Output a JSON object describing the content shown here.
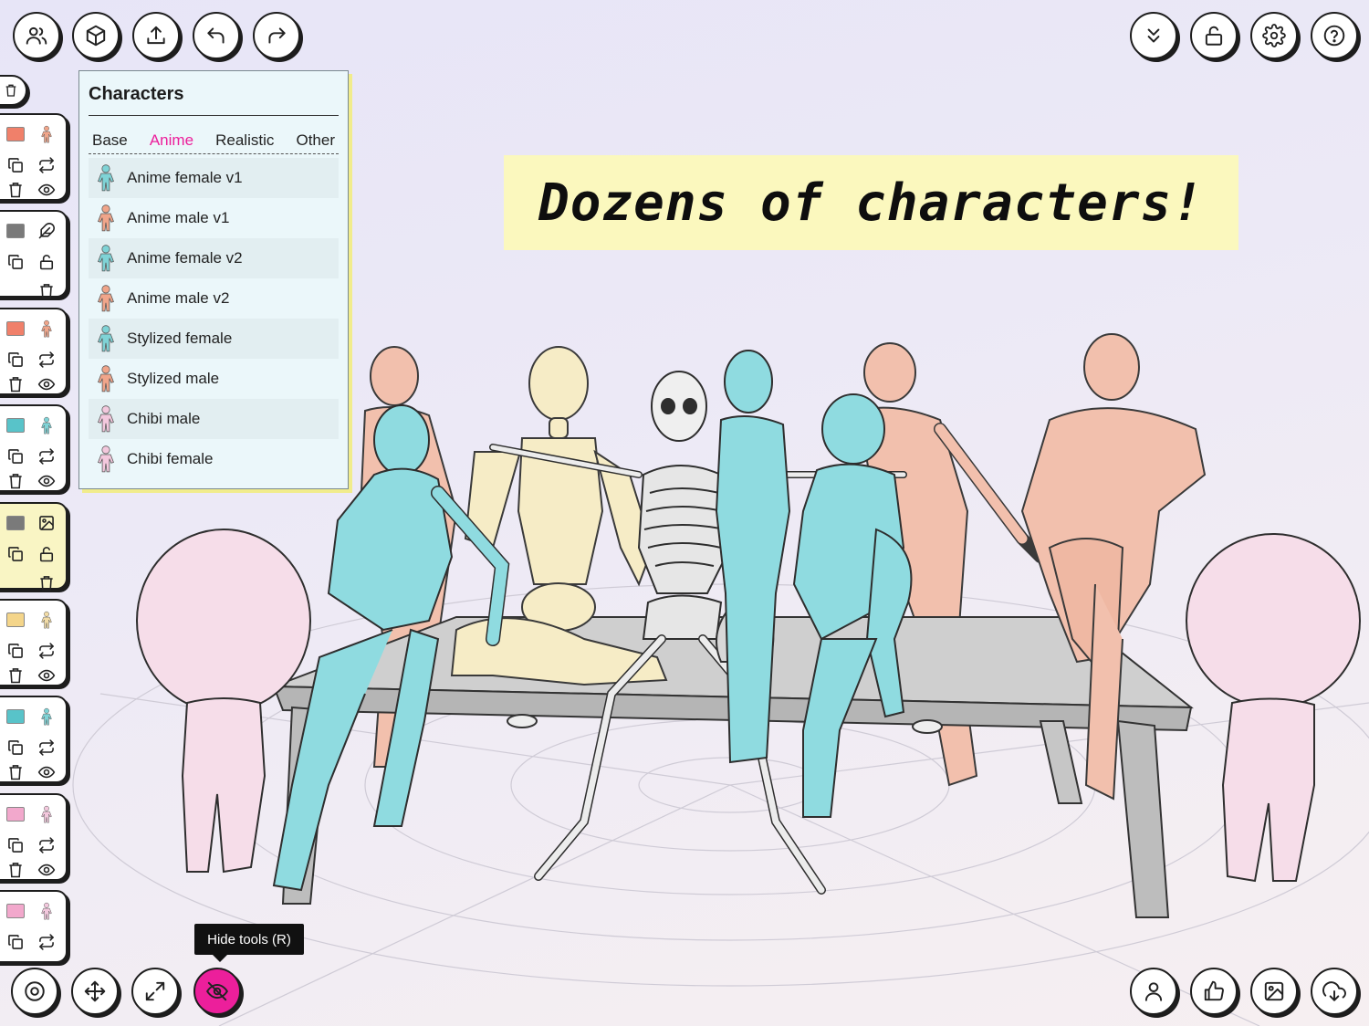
{
  "top_toolbar_left": [
    {
      "name": "characters-button",
      "icon": "users-icon"
    },
    {
      "name": "objects-button",
      "icon": "cube-icon"
    },
    {
      "name": "upload-button",
      "icon": "upload-icon"
    },
    {
      "name": "undo-button",
      "icon": "undo-icon"
    },
    {
      "name": "redo-button",
      "icon": "redo-icon"
    }
  ],
  "top_toolbar_right": [
    {
      "name": "collapse-button",
      "icon": "chevrons-down-icon"
    },
    {
      "name": "lock-button",
      "icon": "unlock-icon"
    },
    {
      "name": "settings-button",
      "icon": "gear-icon"
    },
    {
      "name": "help-button",
      "icon": "help-circle-icon"
    }
  ],
  "bottom_toolbar_left": [
    {
      "name": "rotate-mode-button",
      "icon": "target-icon"
    },
    {
      "name": "move-mode-button",
      "icon": "move-icon"
    },
    {
      "name": "scale-mode-button",
      "icon": "expand-icon"
    },
    {
      "name": "hide-tools-button",
      "icon": "eye-off-icon",
      "active": true
    }
  ],
  "bottom_toolbar_right": [
    {
      "name": "pose-button",
      "icon": "user-icon"
    },
    {
      "name": "like-button",
      "icon": "thumbs-up-icon"
    },
    {
      "name": "background-image-button",
      "icon": "image-icon"
    },
    {
      "name": "download-button",
      "icon": "download-cloud-icon"
    }
  ],
  "tooltip": "Hide tools (R)",
  "banner": {
    "text": "Dozens of characters!"
  },
  "panel": {
    "title": "Characters",
    "tabs": [
      {
        "label": "Base",
        "active": false
      },
      {
        "label": "Anime",
        "active": true
      },
      {
        "label": "Realistic",
        "active": false
      },
      {
        "label": "Other",
        "active": false
      }
    ],
    "items": [
      {
        "label": "Anime female v1",
        "color": "#7fd3d6"
      },
      {
        "label": "Anime male v1",
        "color": "#f0a58a"
      },
      {
        "label": "Anime female v2",
        "color": "#7fd3d6"
      },
      {
        "label": "Anime male v2",
        "color": "#f0a58a"
      },
      {
        "label": "Stylized female",
        "color": "#7fd3d6"
      },
      {
        "label": "Stylized male",
        "color": "#f0a58a"
      },
      {
        "label": "Chibi male",
        "color": "#f3c8dd"
      },
      {
        "label": "Chibi female",
        "color": "#f3c8dd"
      }
    ]
  },
  "scene_cards": [
    {
      "swatch": "#f0806a",
      "thumb": "#f0a58a",
      "rows": [
        "copy-icon",
        "swap-icon",
        "trash-icon",
        "eye-icon"
      ],
      "selected": false
    },
    {
      "swatch": "#7a7a7a",
      "thumb": "feather-icon",
      "rows": [
        "copy-icon",
        "lock-icon",
        "trash-icon"
      ],
      "selected": false
    },
    {
      "swatch": "#f0806a",
      "thumb": "#f0a58a",
      "rows": [
        "copy-icon",
        "swap-icon",
        "trash-icon",
        "eye-icon"
      ],
      "selected": false
    },
    {
      "swatch": "#58c3c9",
      "thumb": "#7fd3d6",
      "rows": [
        "copy-icon",
        "swap-icon",
        "trash-icon",
        "eye-icon"
      ],
      "selected": false
    },
    {
      "swatch": "#7a7a7a",
      "thumb": "image-icon",
      "rows": [
        "copy-icon",
        "lock-icon",
        "trash-icon"
      ],
      "selected": true
    },
    {
      "swatch": "#f4d58a",
      "thumb": "#f2dca6",
      "rows": [
        "copy-icon",
        "swap-icon",
        "trash-icon",
        "eye-icon"
      ],
      "selected": false
    },
    {
      "swatch": "#58c3c9",
      "thumb": "#7fd3d6",
      "rows": [
        "copy-icon",
        "swap-icon",
        "trash-icon",
        "eye-icon"
      ],
      "selected": false
    },
    {
      "swatch": "#f2a8cc",
      "thumb": "#f3c8dd",
      "rows": [
        "copy-icon",
        "swap-icon",
        "trash-icon",
        "eye-icon"
      ],
      "selected": false
    },
    {
      "swatch": "#f2a8cc",
      "thumb": "#f3c8dd",
      "rows": [
        "copy-icon",
        "swap-icon"
      ],
      "selected": false
    }
  ],
  "colors": {
    "accent": "#ec1f9b",
    "banner": "#fbf8be",
    "panel": "#ebf7fa"
  }
}
